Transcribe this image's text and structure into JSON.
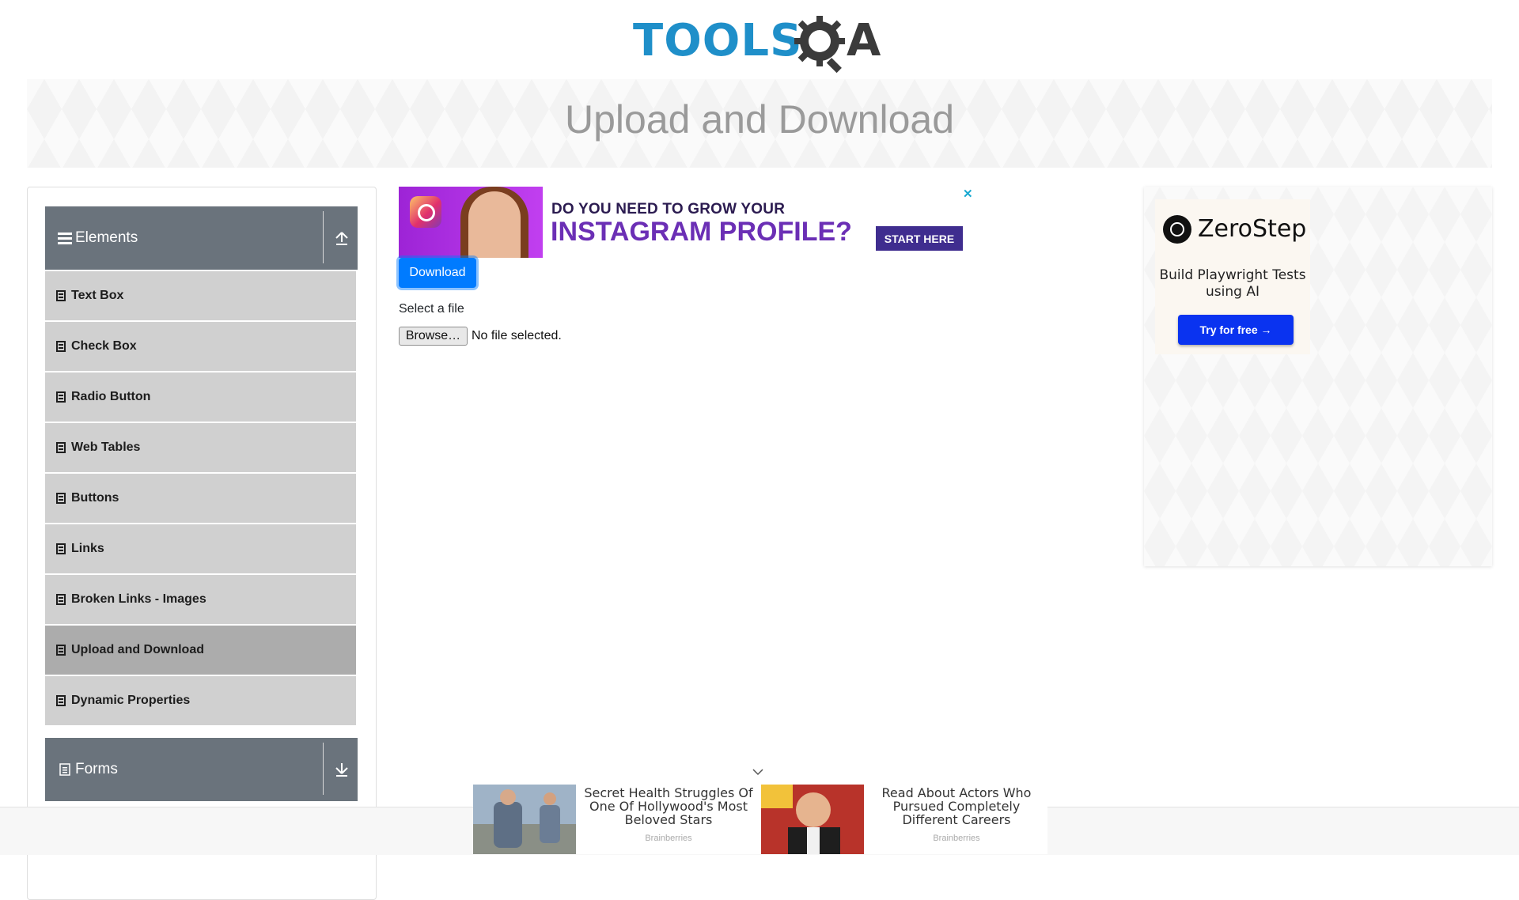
{
  "logo": {
    "word": "TOOLS",
    "qa": "QA"
  },
  "page_title": "Upload and Download",
  "sidebar": {
    "groups": [
      {
        "title": "Elements",
        "icon": "list-icon",
        "toggle_icon": "collapse-up-icon"
      },
      {
        "title": "Forms",
        "icon": "document-icon",
        "toggle_icon": "expand-down-icon"
      }
    ],
    "items": [
      {
        "label": "Text Box"
      },
      {
        "label": "Check Box"
      },
      {
        "label": "Radio Button"
      },
      {
        "label": "Web Tables"
      },
      {
        "label": "Buttons"
      },
      {
        "label": "Links"
      },
      {
        "label": "Broken Links - Images"
      },
      {
        "label": "Upload and Download",
        "active": true
      },
      {
        "label": "Dynamic Properties"
      }
    ]
  },
  "ad_top": {
    "line1": "DO YOU NEED TO GROW YOUR",
    "line2": "INSTAGRAM PROFILE?",
    "cta": "START HERE",
    "close": "✕"
  },
  "main": {
    "download_label": "Download",
    "select_label": "Select a file",
    "browse_label": "Browse…",
    "file_status": "No file selected."
  },
  "right_ad": {
    "brand": "ZeroStep",
    "tagline": "Build Playwright Tests using AI",
    "cta": "Try for free →"
  },
  "bottom_ads": [
    {
      "title": "Secret Health Struggles Of One Of Hollywood's Most Beloved Stars",
      "source": "Brainberries"
    },
    {
      "title": "Read About Actors Who Pursued Completely Different Careers",
      "source": "Brainberries"
    }
  ],
  "colors": {
    "accent": "#007bff",
    "sidebar_header": "#6a737c",
    "menu_item": "#d0d0d0",
    "menu_active": "#acacac",
    "logo_blue": "#1f8fc9"
  }
}
